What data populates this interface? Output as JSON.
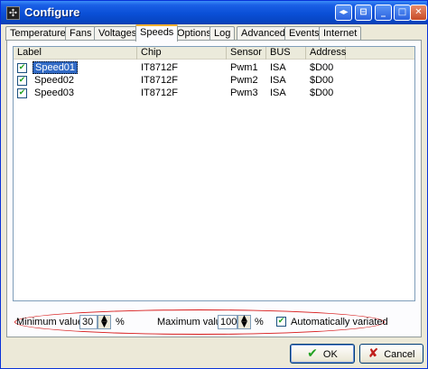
{
  "window": {
    "title": "Configure",
    "icon": "fan-icon",
    "controls": [
      "restore-icon",
      "unknown-icon",
      "minimize-icon",
      "maximize-icon",
      "close-icon"
    ]
  },
  "tabs": [
    {
      "label": "Temperatures"
    },
    {
      "label": "Fans"
    },
    {
      "label": "Voltages"
    },
    {
      "label": "Speeds",
      "active": true
    },
    {
      "label": "Options"
    },
    {
      "label": "Log"
    },
    {
      "label": "Advanced"
    },
    {
      "label": "Events"
    },
    {
      "label": "Internet"
    }
  ],
  "list": {
    "columns": [
      "Label",
      "Chip",
      "Sensor",
      "BUS",
      "Address"
    ],
    "rows": [
      {
        "label": "Speed01",
        "chip": "IT8712F",
        "sensor": "Pwm1",
        "bus": "ISA",
        "address": "$D00",
        "checked": true,
        "selected": true
      },
      {
        "label": "Speed02",
        "chip": "IT8712F",
        "sensor": "Pwm2",
        "bus": "ISA",
        "address": "$D00",
        "checked": true
      },
      {
        "label": "Speed03",
        "chip": "IT8712F",
        "sensor": "Pwm3",
        "bus": "ISA",
        "address": "$D00",
        "checked": true
      }
    ]
  },
  "controls": {
    "min_label": "Minimum value",
    "min_value": "30",
    "max_label": "Maximum value",
    "max_value": "100",
    "percent": "%",
    "auto_label": "Automatically variated",
    "auto_checked": true,
    "highlight_color": "#d81b1b"
  },
  "buttons": {
    "ok": "OK",
    "cancel": "Cancel",
    "ok_color": "#21a121",
    "cancel_color": "#c0201b"
  }
}
